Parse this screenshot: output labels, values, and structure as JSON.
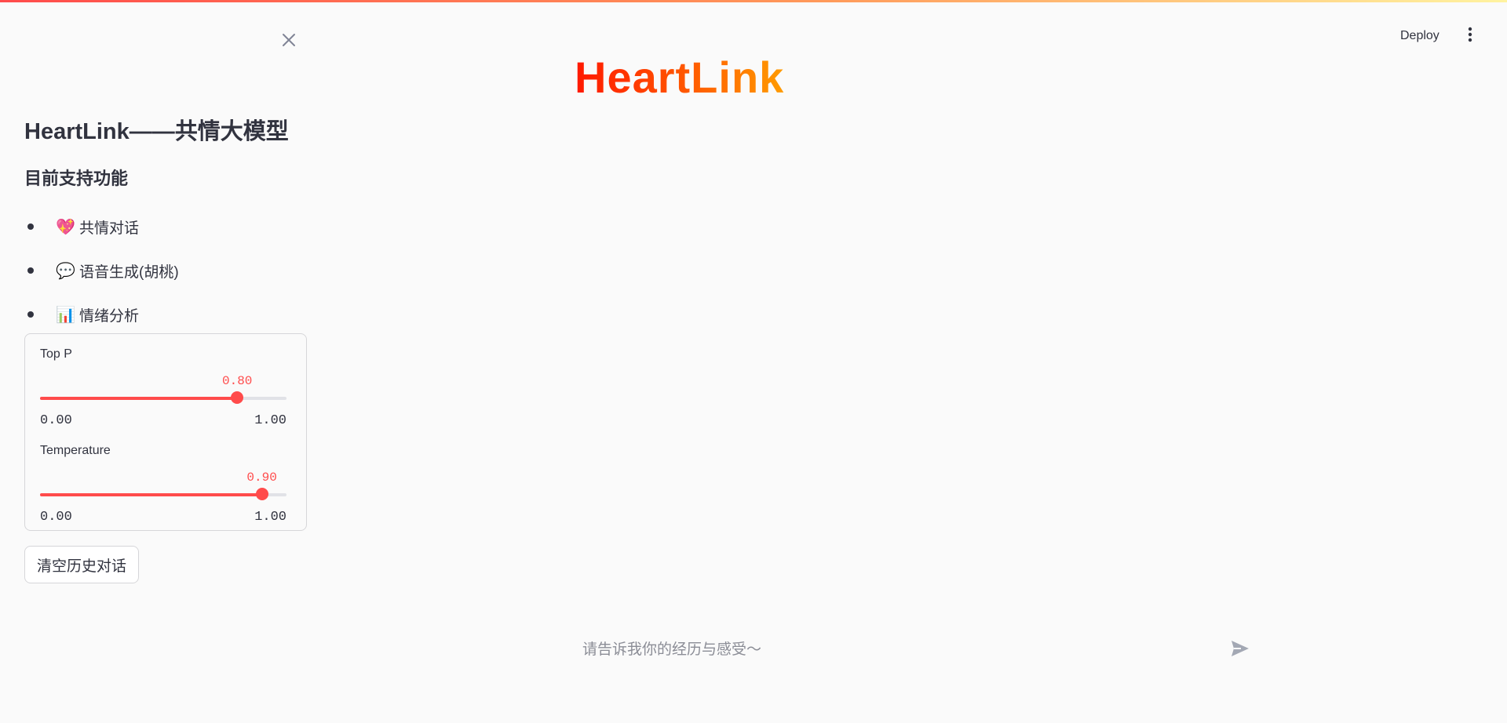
{
  "header": {
    "deploy_label": "Deploy",
    "menu_icon": "vertical-dots-icon"
  },
  "main": {
    "title": "HeartLink",
    "title_colors": [
      "#ff1800",
      "#ff9b00"
    ]
  },
  "sidebar": {
    "close_icon": "close-icon",
    "title": "HeartLink——共情大模型",
    "subtitle": "目前支持功能",
    "features": [
      {
        "icon": "💖",
        "label": "共情对话"
      },
      {
        "icon": "💬",
        "label": "语音生成(胡桃)"
      },
      {
        "icon": "📊",
        "label": "情绪分析"
      }
    ],
    "sliders": [
      {
        "label": "Top P",
        "value": 0.8,
        "value_text": "0.80",
        "min_text": "0.00",
        "max_text": "1.00"
      },
      {
        "label": "Temperature",
        "value": 0.9,
        "value_text": "0.90",
        "min_text": "0.00",
        "max_text": "1.00"
      }
    ],
    "clear_button_label": "清空历史对话"
  },
  "chat": {
    "placeholder": "请告诉我你的经历与感受～",
    "send_icon": "send-icon"
  },
  "colors": {
    "accent": "#ff4b4b",
    "background": "#fafafa",
    "text": "#31333f"
  }
}
